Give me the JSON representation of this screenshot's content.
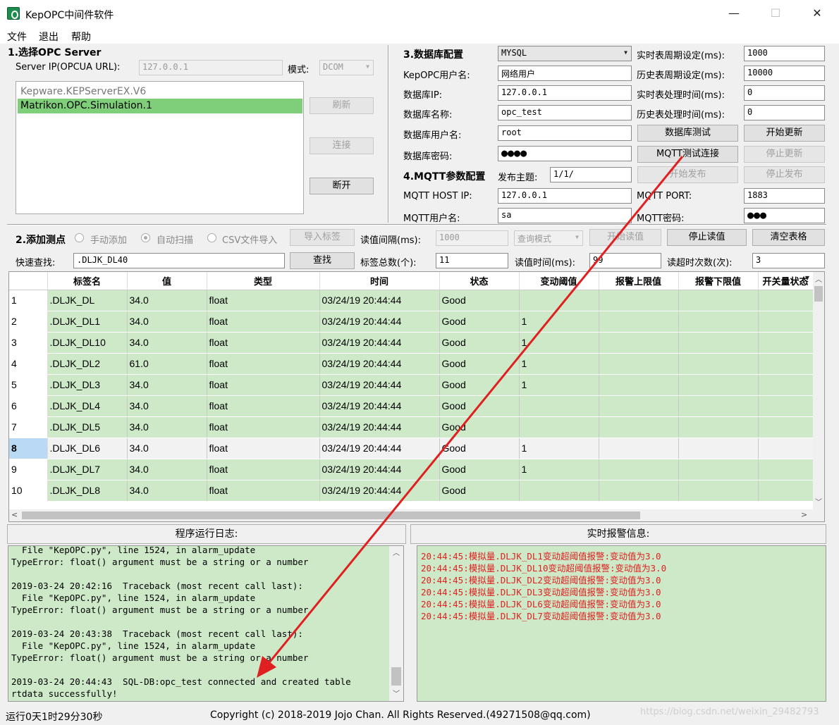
{
  "window": {
    "title": "KepOPC中间件软件"
  },
  "menu": [
    "文件",
    "退出",
    "帮助"
  ],
  "opc": {
    "section_title": "1.选择OPC Server",
    "server_ip_label": "Server IP(OPCUA URL):",
    "server_ip_value": "127.0.0.1",
    "mode_label": "模式:",
    "mode_value": "DCOM",
    "servers": [
      "Kepware.KEPServerEX.V6",
      "Matrikon.OPC.Simulation.1"
    ],
    "refresh_label": "刷新",
    "connect_label": "连接",
    "disconnect_label": "断开"
  },
  "db": {
    "section_title": "3.数据库配置",
    "db_type": "MYSQL",
    "user_label": "KepOPC用户名:",
    "user_value": "网络用户",
    "ip_label": "数据库IP:",
    "ip_value": "127.0.0.1",
    "name_label": "数据库名称:",
    "name_value": "opc_test",
    "dbuser_label": "数据库用户名:",
    "dbuser_value": "root",
    "pwd_label": "数据库密码:",
    "pwd_value": "●●●●",
    "rt_period_label": "实时表周期设定(ms):",
    "rt_period_value": "1000",
    "hist_period_label": "历史表周期设定(ms):",
    "hist_period_value": "10000",
    "rt_proc_label": "实时表处理时间(ms):",
    "rt_proc_value": "0",
    "hist_proc_label": "历史表处理时间(ms):",
    "hist_proc_value": "0",
    "test_label": "数据库测试",
    "start_update_label": "开始更新",
    "stop_update_label": "停止更新"
  },
  "mqtt": {
    "section_title": "4.MQTT参数配置",
    "topic_label": "发布主题:",
    "topic_value": "1/1/",
    "host_label": "MQTT HOST IP:",
    "host_value": "127.0.0.1",
    "port_label": "MQTT PORT:",
    "port_value": "1883",
    "user_label": "MQTT用户名:",
    "user_value": "sa",
    "pwd_label": "MQTT密码:",
    "pwd_value": "●●●",
    "test_label": "MQTT测试连接",
    "start_pub_label": "开始发布",
    "stop_pub_label": "停止发布"
  },
  "points": {
    "section_title": "2.添加测点",
    "manual_label": "手动添加",
    "auto_label": "自动扫描",
    "csv_label": "CSV文件导入",
    "import_label": "导入标签",
    "interval_label": "读值间隔(ms):",
    "interval_value": "1000",
    "query_mode_value": "查询模式",
    "start_read_label": "开始读值",
    "stop_read_label": "停止读值",
    "clear_label": "清空表格",
    "search_label": "快速查找:",
    "search_value": ".DLJK_DL40",
    "find_label": "查找",
    "total_label": "标签总数(个):",
    "total_value": "11",
    "read_time_label": "读值时间(ms):",
    "read_time_value": "99",
    "timeout_label": "读超时次数(次):",
    "timeout_value": "3"
  },
  "table": {
    "columns": [
      "",
      "标签名",
      "值",
      "类型",
      "时间",
      "状态",
      "变动阈值",
      "报警上限值",
      "报警下限值",
      "开关量状态"
    ],
    "rows": [
      [
        "1",
        ".DLJK_DL",
        "34.0",
        "float",
        "03/24/19 20:44:44",
        "Good",
        "",
        "",
        "",
        ""
      ],
      [
        "2",
        ".DLJK_DL1",
        "34.0",
        "float",
        "03/24/19 20:44:44",
        "Good",
        "1",
        "",
        "",
        ""
      ],
      [
        "3",
        ".DLJK_DL10",
        "34.0",
        "float",
        "03/24/19 20:44:44",
        "Good",
        "1",
        "",
        "",
        ""
      ],
      [
        "4",
        ".DLJK_DL2",
        "61.0",
        "float",
        "03/24/19 20:44:44",
        "Good",
        "1",
        "",
        "",
        ""
      ],
      [
        "5",
        ".DLJK_DL3",
        "34.0",
        "float",
        "03/24/19 20:44:44",
        "Good",
        "1",
        "",
        "",
        ""
      ],
      [
        "6",
        ".DLJK_DL4",
        "34.0",
        "float",
        "03/24/19 20:44:44",
        "Good",
        "",
        "",
        "",
        ""
      ],
      [
        "7",
        ".DLJK_DL5",
        "34.0",
        "float",
        "03/24/19 20:44:44",
        "Good",
        "",
        "",
        "",
        ""
      ],
      [
        "8",
        ".DLJK_DL6",
        "34.0",
        "float",
        "03/24/19 20:44:44",
        "Good",
        "1",
        "",
        "",
        ""
      ],
      [
        "9",
        ".DLJK_DL7",
        "34.0",
        "float",
        "03/24/19 20:44:44",
        "Good",
        "1",
        "",
        "",
        ""
      ],
      [
        "10",
        ".DLJK_DL8",
        "34.0",
        "float",
        "03/24/19 20:44:44",
        "Good",
        "",
        "",
        "",
        ""
      ]
    ],
    "selected_row": 7
  },
  "log": {
    "title": "程序运行日志:",
    "text": "  File \"KepOPC.py\", line 1524, in alarm_update\nTypeError: float() argument must be a string or a number\n\n2019-03-24 20:42:16  Traceback (most recent call last):\n  File \"KepOPC.py\", line 1524, in alarm_update\nTypeError: float() argument must be a string or a number\n\n2019-03-24 20:43:38  Traceback (most recent call last):\n  File \"KepOPC.py\", line 1524, in alarm_update\nTypeError: float() argument must be a string or a number\n\n2019-03-24 20:44:43  SQL-DB:opc_test connected and created table\nrtdata successfully!"
  },
  "alarms": {
    "title": "实时报警信息:",
    "lines": [
      "20:44:45:模拟量.DLJK_DL1变动超阈值报警:变动值为3.0",
      "20:44:45:模拟量.DLJK_DL10变动超阈值报警:变动值为3.0",
      "20:44:45:模拟量.DLJK_DL2变动超阈值报警:变动值为3.0",
      "20:44:45:模拟量.DLJK_DL3变动超阈值报警:变动值为3.0",
      "20:44:45:模拟量.DLJK_DL6变动超阈值报警:变动值为3.0",
      "20:44:45:模拟量.DLJK_DL7变动超阈值报警:变动值为3.0"
    ],
    "color": "#e02020"
  },
  "status": {
    "uptime": "运行0天1时29分30秒",
    "copyright": "Copyright (c) 2018-2019 Jojo Chan. All Rights Reserved.(49271508@qq.com)",
    "watermark": "https://blog.csdn.net/weixin_29482793"
  },
  "colors": {
    "row_green": "#cde9c8",
    "selected_list": "#7fcf7a",
    "arrow": "#e02020"
  }
}
